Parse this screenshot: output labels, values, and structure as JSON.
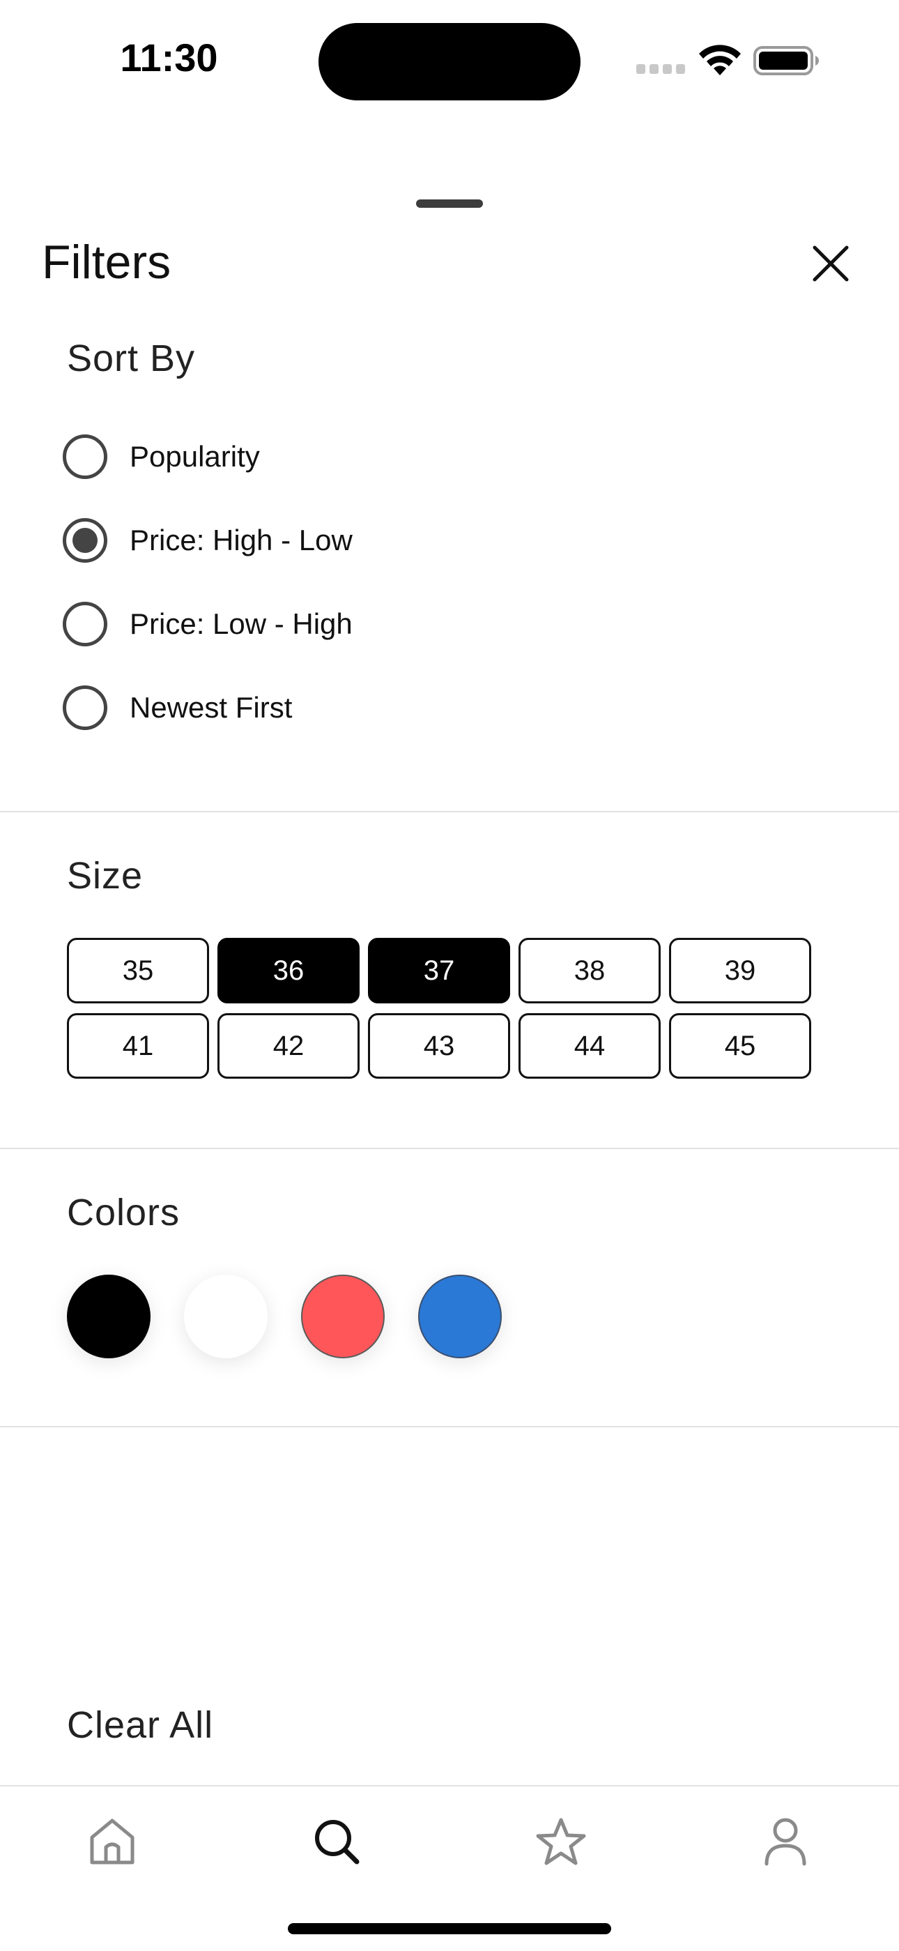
{
  "status_bar": {
    "time": "11:30"
  },
  "sheet": {
    "title": "Filters",
    "close_icon": "close-icon"
  },
  "sort": {
    "heading": "Sort By",
    "options": [
      {
        "label": "Popularity",
        "selected": false
      },
      {
        "label": "Price: High - Low",
        "selected": true
      },
      {
        "label": "Price: Low - High",
        "selected": false
      },
      {
        "label": "Newest First",
        "selected": false
      }
    ]
  },
  "size": {
    "heading": "Size",
    "options": [
      {
        "label": "35",
        "selected": false
      },
      {
        "label": "36",
        "selected": true
      },
      {
        "label": "37",
        "selected": true
      },
      {
        "label": "38",
        "selected": false
      },
      {
        "label": "39",
        "selected": false
      },
      {
        "label": "41",
        "selected": false
      },
      {
        "label": "42",
        "selected": false
      },
      {
        "label": "43",
        "selected": false
      },
      {
        "label": "44",
        "selected": false
      },
      {
        "label": "45",
        "selected": false
      }
    ]
  },
  "colors": {
    "heading": "Colors",
    "swatches": [
      {
        "name": "black",
        "hex": "#000000"
      },
      {
        "name": "white",
        "hex": "#ffffff"
      },
      {
        "name": "red",
        "hex": "#ff5759"
      },
      {
        "name": "blue",
        "hex": "#2a79d6"
      }
    ]
  },
  "footer": {
    "clear_all": "Clear All"
  },
  "tab_bar": {
    "items": [
      {
        "icon": "home-icon",
        "active": false
      },
      {
        "icon": "search-icon",
        "active": true
      },
      {
        "icon": "star-icon",
        "active": false
      },
      {
        "icon": "profile-icon",
        "active": false
      }
    ]
  }
}
